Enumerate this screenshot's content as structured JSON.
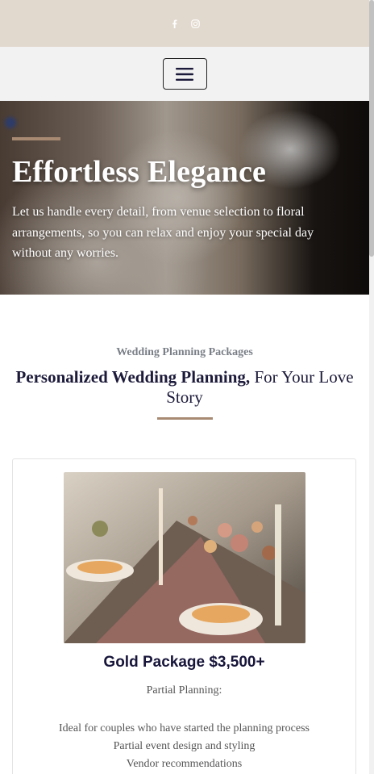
{
  "topbar": {
    "social": [
      "facebook-icon",
      "instagram-icon"
    ]
  },
  "hero": {
    "title": "Effortless Elegance",
    "text": "Let us handle every detail, from venue selection to floral arrangements, so you can relax and enjoy your special day without any worries."
  },
  "intro": {
    "eyebrow": "Wedding Planning Packages",
    "title_strong": "Personalized Wedding Planning,",
    "title_rest": " For Your Love Story"
  },
  "package": {
    "title": "Gold Package $3,500+",
    "subtitle": "Partial Planning:",
    "features": [
      "Ideal for couples who have started the planning process",
      "Partial event design and styling",
      "Vendor recommendations"
    ]
  },
  "colors": {
    "accent": "#a88a73",
    "topbar": "#e2d9ce",
    "navy": "#1c1a3a"
  }
}
